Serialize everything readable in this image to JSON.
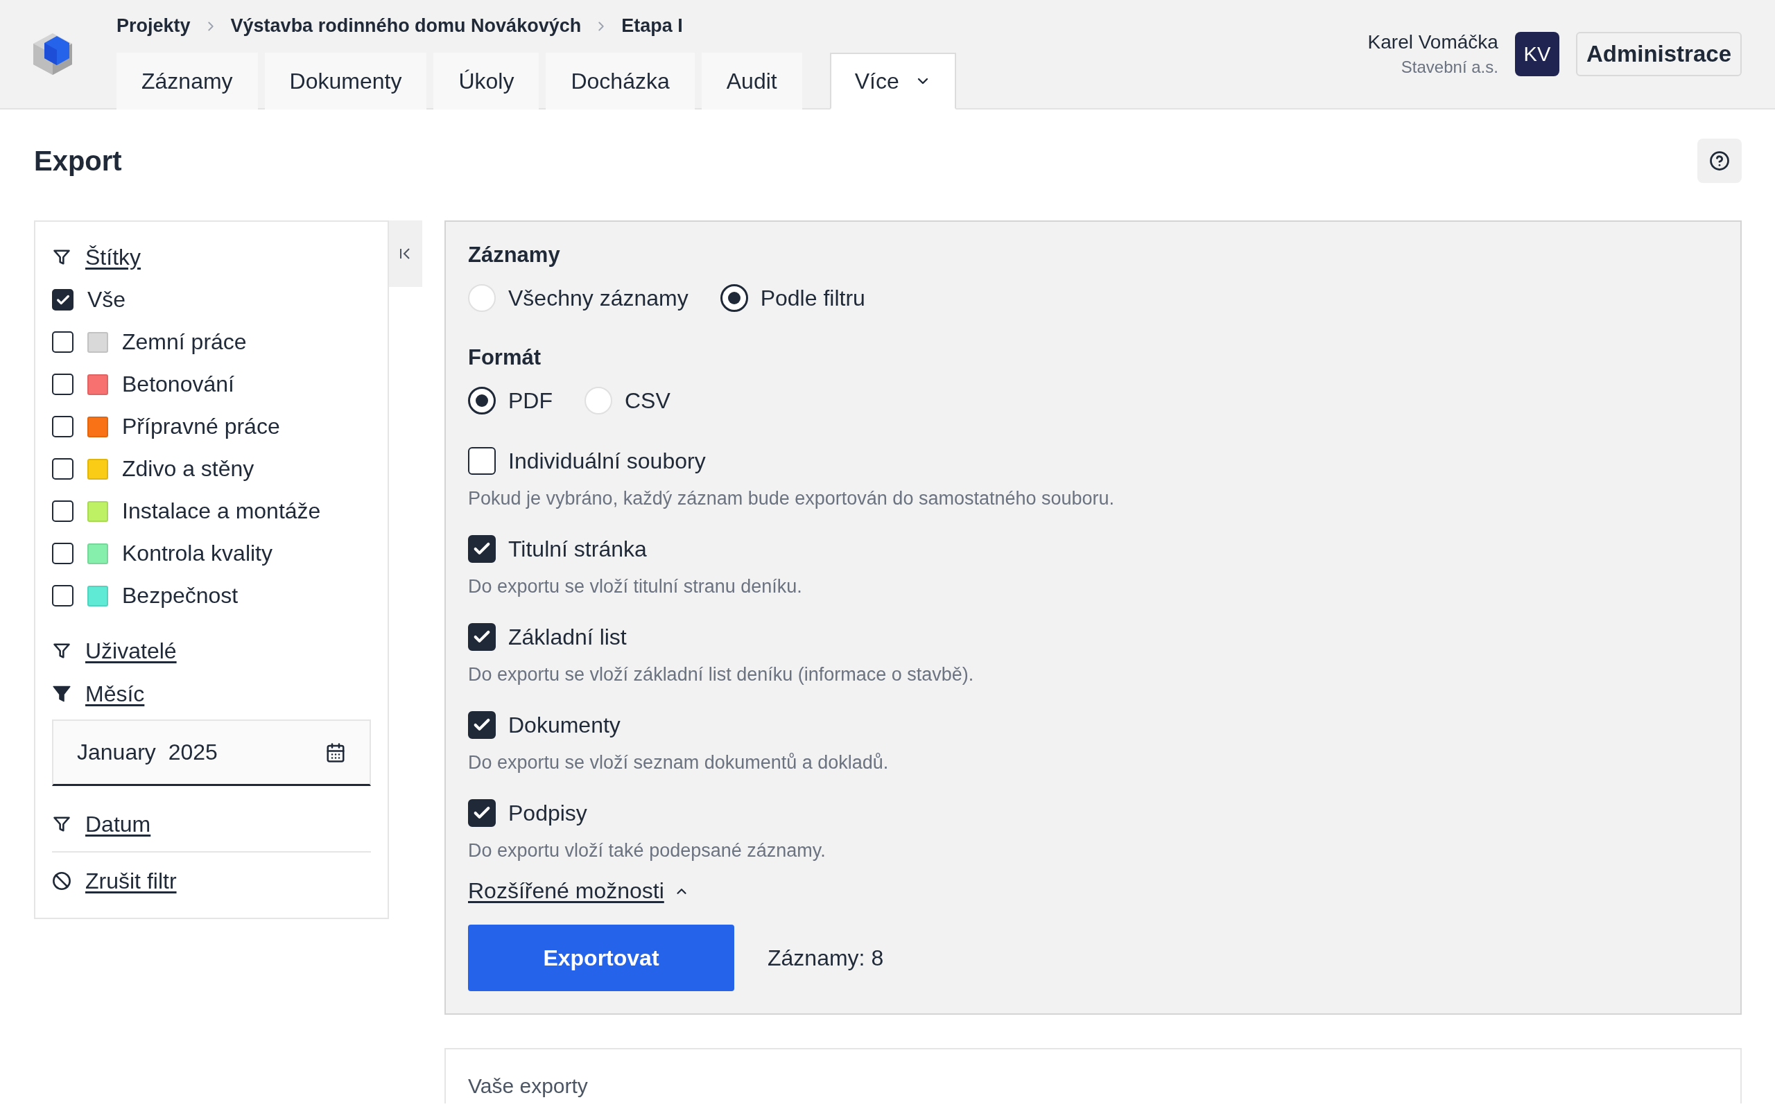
{
  "breadcrumb": [
    "Projekty",
    "Výstavba rodinného domu Novákových",
    "Etapa I"
  ],
  "tabs": [
    {
      "label": "Záznamy",
      "selected": false,
      "kind": "link"
    },
    {
      "label": "Dokumenty",
      "selected": false,
      "kind": "link"
    },
    {
      "label": "Úkoly",
      "selected": false,
      "kind": "link"
    },
    {
      "label": "Docházka",
      "selected": false,
      "kind": "link"
    },
    {
      "label": "Audit",
      "selected": false,
      "kind": "link"
    },
    {
      "label": "Více",
      "selected": true,
      "kind": "dropdown"
    }
  ],
  "user": {
    "name": "Karel Vomáčka",
    "company": "Stavební a.s.",
    "initials": "KV"
  },
  "admin_button": "Administrace",
  "page_title": "Export",
  "sidebar": {
    "filters": [
      {
        "label": "Štítky",
        "active": false,
        "tags": [
          {
            "label": "Vše",
            "checked": true,
            "kind": "all"
          },
          {
            "label": "Zemní práce",
            "checked": false,
            "kind": "tag",
            "color": "#d9d9d9"
          },
          {
            "label": "Betonování",
            "checked": false,
            "kind": "tag",
            "color": "#f87171"
          },
          {
            "label": "Přípravné práce",
            "checked": false,
            "kind": "tag",
            "color": "#f97316"
          },
          {
            "label": "Zdivo a stěny",
            "checked": false,
            "kind": "tag",
            "color": "#facc15"
          },
          {
            "label": "Instalace a montáže",
            "checked": false,
            "kind": "tag",
            "color": "#bef264"
          },
          {
            "label": "Kontrola kvality",
            "checked": false,
            "kind": "tag",
            "color": "#86efac"
          },
          {
            "label": "Bezpečnost",
            "checked": false,
            "kind": "tag",
            "color": "#5eead4"
          }
        ]
      },
      {
        "label": "Uživatelé",
        "active": false
      },
      {
        "label": "Měsíc",
        "active": true,
        "field": {
          "value": "January  2025"
        }
      },
      {
        "label": "Datum",
        "active": false
      }
    ],
    "clear_filter": "Zrušit filtr"
  },
  "export_form": {
    "records": {
      "heading": "Záznamy",
      "options": [
        {
          "label": "Všechny záznamy",
          "selected": false
        },
        {
          "label": "Podle filtru",
          "selected": true
        }
      ]
    },
    "format": {
      "heading": "Formát",
      "options": [
        {
          "label": "PDF",
          "selected": true
        },
        {
          "label": "CSV",
          "selected": false
        }
      ]
    },
    "options": [
      {
        "label": "Individuální soubory",
        "checked": false,
        "hint": "Pokud je vybráno, každý záznam bude exportován do samostatného souboru."
      },
      {
        "label": "Titulní stránka",
        "checked": true,
        "hint": "Do exportu se vloží titulní stranu deníku."
      },
      {
        "label": "Základní list",
        "checked": true,
        "hint": "Do exportu se vloží základní list deníku (informace o stavbě)."
      },
      {
        "label": "Dokumenty",
        "checked": true,
        "hint": "Do exportu se vloží seznam dokumentů a dokladů."
      },
      {
        "label": "Podpisy",
        "checked": true,
        "hint": "Do exportu vloží také podepsané záznamy."
      }
    ],
    "advanced": {
      "label": "Rozšířené možnosti",
      "expanded": true
    },
    "export_button": "Exportovat",
    "record_count": "Záznamy: 8"
  },
  "exports_panel": {
    "title": "Vaše exporty"
  }
}
